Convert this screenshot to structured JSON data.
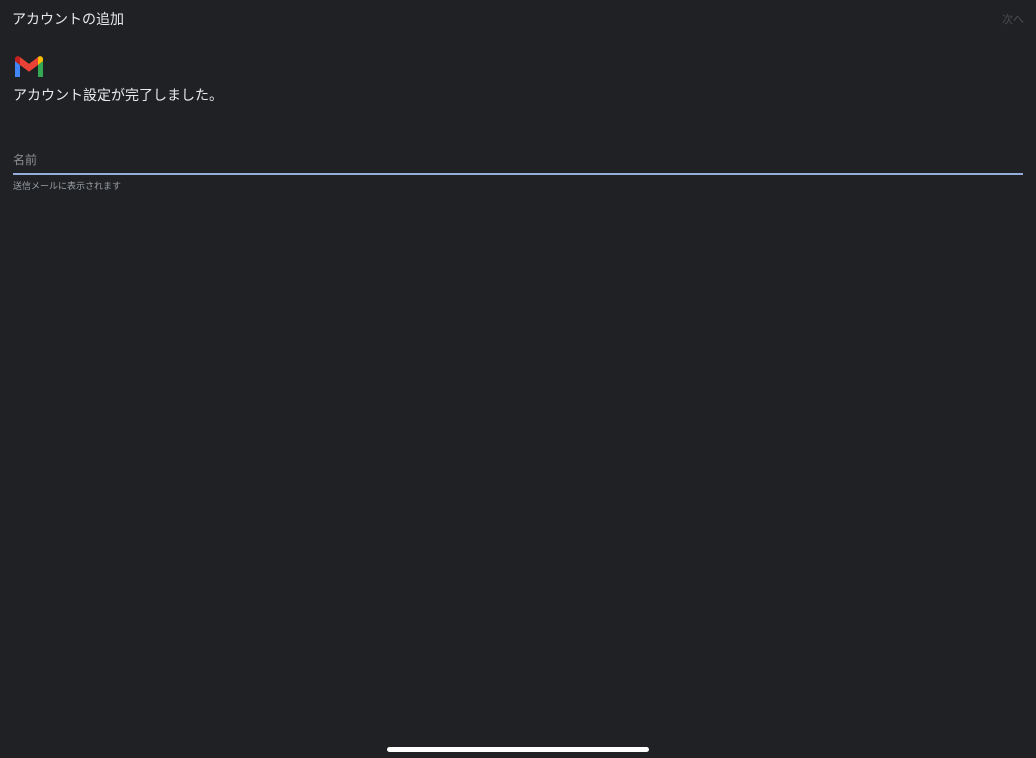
{
  "header": {
    "title": "アカウントの追加",
    "next_label": "次へ"
  },
  "gmail_logo": {
    "icon": "gmail-logo",
    "colors": {
      "blue": "#4285F4",
      "red": "#EA4335",
      "yellow": "#FBBC04",
      "green": "#34A853"
    }
  },
  "main": {
    "setup_message": "アカウント設定が完了しました。",
    "name_field": {
      "placeholder": "名前",
      "value": "",
      "helper_text": "送信メールに表示されます"
    }
  },
  "theme": {
    "background": "#202124",
    "accent": "#A8C7FA"
  }
}
